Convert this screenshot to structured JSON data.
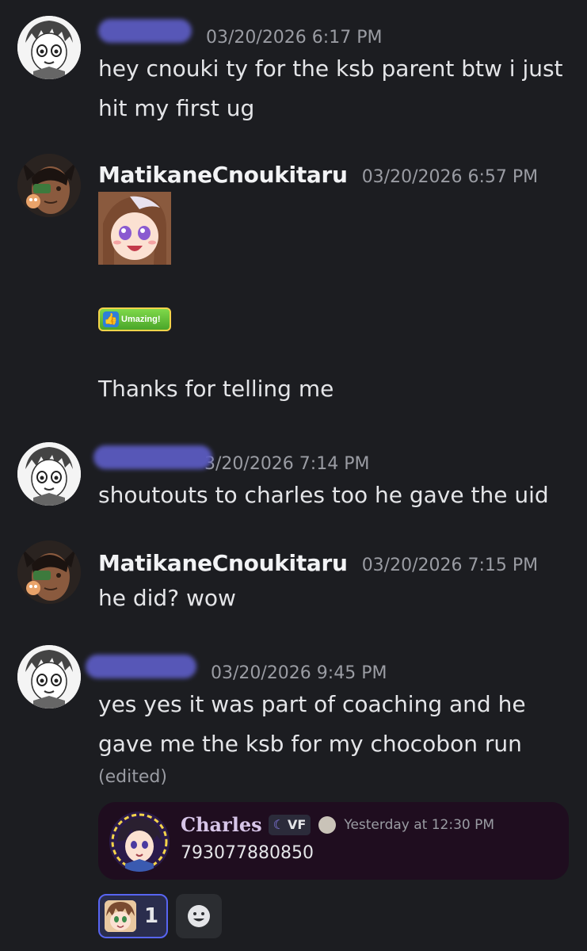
{
  "messages": [
    {
      "username": "",
      "timestamp": "03/20/2026 6:17 PM",
      "text": "hey cnouki ty for the ksb parent btw i just hit my first ug"
    },
    {
      "username": "MatikaneCnoukitaru",
      "timestamp": "03/20/2026 6:57 PM",
      "emoji_badge": "Umazing!",
      "text": "Thanks for telling me"
    },
    {
      "username": "",
      "timestamp": "3/20/2026 7:14 PM",
      "text": "shoutouts to charles too he gave the uid"
    },
    {
      "username": "MatikaneCnoukitaru",
      "timestamp": "03/20/2026 7:15 PM",
      "text": "he did? wow"
    },
    {
      "username": "",
      "timestamp": "03/20/2026 9:45 PM",
      "text": "yes yes it was part of coaching and he gave me the ksb for my chocobon run",
      "edited": "(edited)"
    }
  ],
  "reply": {
    "username": "Charles",
    "tag": "VF",
    "timestamp": "Yesterday at 12:30 PM",
    "text": "793077880850"
  },
  "reactions": [
    {
      "emoji": "umamusume-face",
      "count": "1"
    }
  ],
  "icons": {
    "add_reaction": "smiley-add-reaction-icon"
  },
  "colors": {
    "background": "#1c1d21",
    "redaction": "#5b5bc0",
    "reply_card": "#1f0d1f",
    "reaction_border": "#5865f2"
  }
}
